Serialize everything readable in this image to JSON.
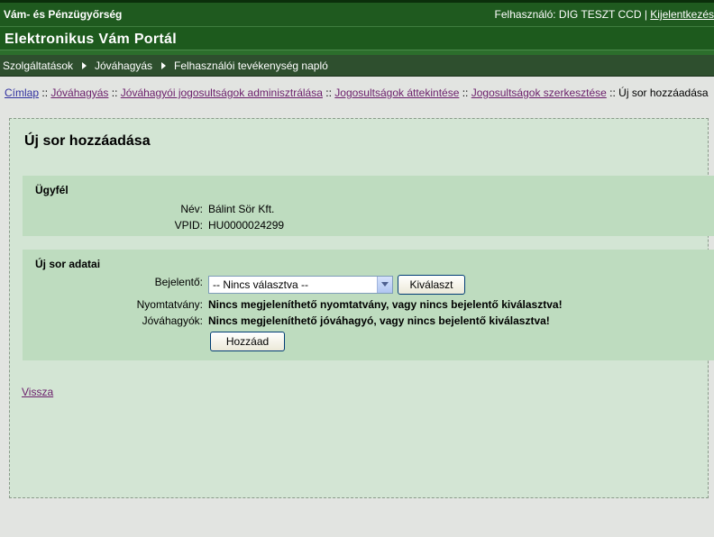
{
  "header": {
    "org": "Vám- és Pénzügyőrség",
    "user_label": "Felhasználó: DIG TESZT CCD |",
    "logout": "Kijelentkezés",
    "portal_title": "Elektronikus Vám Portál"
  },
  "nav": {
    "items": [
      "Szolgáltatások",
      "Jóváhagyás",
      "Felhasználói tevékenység napló"
    ]
  },
  "breadcrumb": {
    "links": [
      "Címlap",
      "Jóváhagyás",
      "Jóváhagyói jogosultságok adminisztrálása",
      "Jogosultságok áttekintése",
      "Jogosultságok szerkesztése"
    ],
    "separator": "::",
    "current": "Új sor hozzáadása"
  },
  "page": {
    "title": "Új sor hozzáadása",
    "client_section": {
      "title": "Ügyfél",
      "name_label": "Név:",
      "name_value": "Bálint Sör Kft.",
      "vpid_label": "VPID:",
      "vpid_value": "HU0000024299"
    },
    "row_section": {
      "title": "Új sor adatai",
      "reporter_label": "Bejelentő:",
      "reporter_selected": "-- Nincs választva --",
      "select_button": "Kiválaszt",
      "form_label": "Nyomtatvány:",
      "form_value": "Nincs megjeleníthető nyomtatvány, vagy nincs bejelentő kiválasztva!",
      "approvers_label": "Jóváhagyók:",
      "approvers_value": "Nincs megjeleníthető jóváhagyó, vagy nincs bejelentő kiválasztva!",
      "add_button": "Hozzáad"
    },
    "back_link": "Vissza"
  }
}
